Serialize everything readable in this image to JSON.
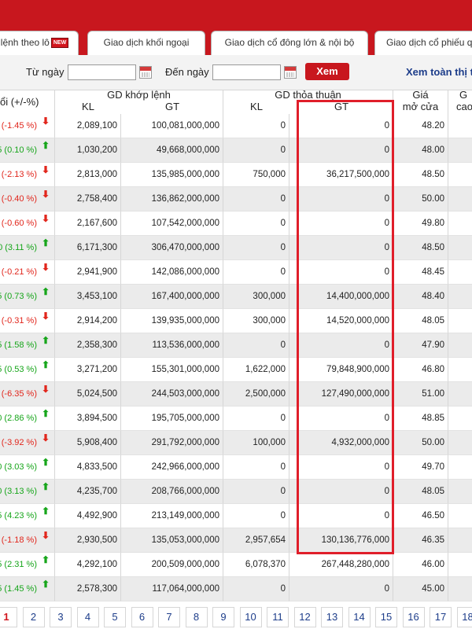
{
  "tabs": [
    {
      "label": "lệnh theo lô",
      "badge": "NEW"
    },
    {
      "label": "Giao dịch khối ngoại"
    },
    {
      "label": "Giao dịch cổ đông lớn & nội bộ"
    },
    {
      "label": "Giao dịch cổ phiếu q"
    }
  ],
  "filter": {
    "from_label": "Từ ngày",
    "to_label": "Đến ngày",
    "view_button": "Xem",
    "view_all_link": "Xem toàn thị tr"
  },
  "table": {
    "col_change": "ổi (+/-%)",
    "group_matched": "GD khớp lệnh",
    "group_negotiated": "GD thỏa thuận",
    "sub_kl": "KL",
    "sub_gt": "GT",
    "col_open_line1": "Giá",
    "col_open_line2": "mở cửa",
    "col_high_line1": "G",
    "col_high_line2": "cao",
    "rows": [
      {
        "change": "(-1.45 %)",
        "trend": "down",
        "kl1": "2,089,100",
        "gt1": "100,081,000,000",
        "kl2": "0",
        "gt2": "0",
        "open": "48.20"
      },
      {
        "change": "5 (0.10 %)",
        "trend": "up",
        "kl1": "1,030,200",
        "gt1": "49,668,000,000",
        "kl2": "0",
        "gt2": "0",
        "open": "48.00"
      },
      {
        "change": "(-2.13 %)",
        "trend": "down",
        "kl1": "2,813,000",
        "gt1": "135,985,000,000",
        "kl2": "750,000",
        "gt2": "36,217,500,000",
        "open": "48.50"
      },
      {
        "change": "(-0.40 %)",
        "trend": "down",
        "kl1": "2,758,400",
        "gt1": "136,862,000,000",
        "kl2": "0",
        "gt2": "0",
        "open": "50.00"
      },
      {
        "change": "(-0.60 %)",
        "trend": "down",
        "kl1": "2,167,600",
        "gt1": "107,542,000,000",
        "kl2": "0",
        "gt2": "0",
        "open": "49.80"
      },
      {
        "change": "0 (3.11 %)",
        "trend": "up",
        "kl1": "6,171,300",
        "gt1": "306,470,000,000",
        "kl2": "0",
        "gt2": "0",
        "open": "48.50"
      },
      {
        "change": "(-0.21 %)",
        "trend": "down",
        "kl1": "2,941,900",
        "gt1": "142,086,000,000",
        "kl2": "0",
        "gt2": "0",
        "open": "48.45"
      },
      {
        "change": "5 (0.73 %)",
        "trend": "up",
        "kl1": "3,453,100",
        "gt1": "167,400,000,000",
        "kl2": "300,000",
        "gt2": "14,400,000,000",
        "open": "48.40"
      },
      {
        "change": "(-0.31 %)",
        "trend": "down",
        "kl1": "2,914,200",
        "gt1": "139,935,000,000",
        "kl2": "300,000",
        "gt2": "14,520,000,000",
        "open": "48.05"
      },
      {
        "change": "5 (1.58 %)",
        "trend": "up",
        "kl1": "2,358,300",
        "gt1": "113,536,000,000",
        "kl2": "0",
        "gt2": "0",
        "open": "47.90"
      },
      {
        "change": "5 (0.53 %)",
        "trend": "up",
        "kl1": "3,271,200",
        "gt1": "155,301,000,000",
        "kl2": "1,622,000",
        "gt2": "79,848,900,000",
        "open": "46.80"
      },
      {
        "change": "(-6.35 %)",
        "trend": "down",
        "kl1": "5,024,500",
        "gt1": "244,503,000,000",
        "kl2": "2,500,000",
        "gt2": "127,490,000,000",
        "open": "51.00"
      },
      {
        "change": "0 (2.86 %)",
        "trend": "up",
        "kl1": "3,894,500",
        "gt1": "195,705,000,000",
        "kl2": "0",
        "gt2": "0",
        "open": "48.85"
      },
      {
        "change": "(-3.92 %)",
        "trend": "down",
        "kl1": "5,908,400",
        "gt1": "291,792,000,000",
        "kl2": "100,000",
        "gt2": "4,932,000,000",
        "open": "50.00"
      },
      {
        "change": "0 (3.03 %)",
        "trend": "up",
        "kl1": "4,833,500",
        "gt1": "242,966,000,000",
        "kl2": "0",
        "gt2": "0",
        "open": "49.70"
      },
      {
        "change": "0 (3.13 %)",
        "trend": "up",
        "kl1": "4,235,700",
        "gt1": "208,766,000,000",
        "kl2": "0",
        "gt2": "0",
        "open": "48.05"
      },
      {
        "change": "5 (4.23 %)",
        "trend": "up",
        "kl1": "4,492,900",
        "gt1": "213,149,000,000",
        "kl2": "0",
        "gt2": "0",
        "open": "46.50"
      },
      {
        "change": "(-1.18 %)",
        "trend": "down",
        "kl1": "2,930,500",
        "gt1": "135,053,000,000",
        "kl2": "2,957,654",
        "gt2": "130,136,776,000",
        "open": "46.35"
      },
      {
        "change": "5 (2.31 %)",
        "trend": "up",
        "kl1": "4,292,100",
        "gt1": "200,509,000,000",
        "kl2": "6,078,370",
        "gt2": "267,448,280,000",
        "open": "46.00"
      },
      {
        "change": "5 (1.45 %)",
        "trend": "up",
        "kl1": "2,578,300",
        "gt1": "117,064,000,000",
        "kl2": "0",
        "gt2": "0",
        "open": "45.00"
      }
    ]
  },
  "pagination": [
    "1",
    "2",
    "3",
    "4",
    "5",
    "6",
    "7",
    "8",
    "9",
    "10",
    "11",
    "12",
    "13",
    "14",
    "15",
    "16",
    "17",
    "18"
  ],
  "pagination_active": "1",
  "colors": {
    "brand_red": "#c8171e",
    "up_green": "#16a51a",
    "down_red": "#e1261c",
    "highlight_box": "#e01e2a",
    "link_blue": "#1d3d8a"
  },
  "icons": {
    "up": "arrow-up-icon",
    "down": "arrow-down-icon",
    "calendar": "calendar-icon"
  }
}
